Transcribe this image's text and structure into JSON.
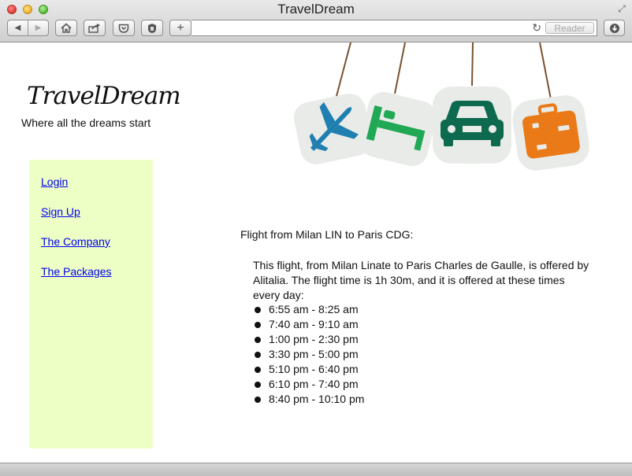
{
  "window": {
    "title": "TravelDream"
  },
  "toolbar": {
    "back_icon": "◀",
    "forward_icon": "▶",
    "home_icon": "home-icon",
    "share_icon": "share-icon",
    "pocket_icon": "pocket-icon",
    "extension_icon": "shield-icon",
    "new_tab_label": "+",
    "address_value": "",
    "reader_label": "Reader",
    "download_icon": "download-icon"
  },
  "site": {
    "logo": "TravelDream",
    "tagline": "Where all the dreams start"
  },
  "hero": {
    "tags": [
      "airplane-icon",
      "bed-icon",
      "car-icon",
      "suitcase-icon"
    ],
    "colors": {
      "airplane": "#1f7fb0",
      "bed": "#21a854",
      "car": "#0e6a4e",
      "suitcase": "#e97a17",
      "string": "#7a5230"
    }
  },
  "sidebar": {
    "background": "#eeffc6",
    "links": [
      {
        "label": "Login"
      },
      {
        "label": "Sign Up"
      },
      {
        "label": "The Company"
      },
      {
        "label": "The Packages"
      }
    ]
  },
  "main": {
    "heading": "Flight from Milan LIN to Paris CDG:",
    "description": "This flight, from Milan Linate to Paris Charles de Gaulle, is offered by Alitalia. The flight time is 1h 30m, and it is offered at these times every day:",
    "times": [
      "6:55 am - 8:25 am",
      "7:40 am - 9:10 am",
      "1:00 pm - 2:30 pm",
      "3:30 pm - 5:00 pm",
      "5:10 pm - 6:40 pm",
      "6:10 pm - 7:40 pm",
      "8:40 pm - 10:10 pm"
    ]
  }
}
